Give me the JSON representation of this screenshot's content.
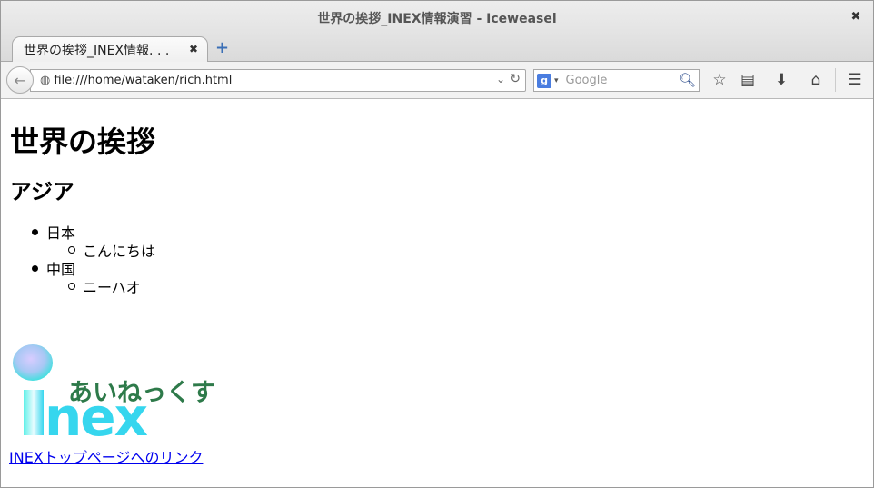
{
  "window": {
    "title": "世界の挨拶_INEX情報演習  -  Iceweasel",
    "close_glyph": "✖"
  },
  "tabs": [
    {
      "label": "世界の挨拶_INEX情報. . .",
      "active": true
    }
  ],
  "new_tab_glyph": "+",
  "navbar": {
    "url": "file:///home/wataken/rich.html",
    "search_placeholder": "Google",
    "search_engine": "g"
  },
  "page": {
    "heading": "世界の挨拶",
    "region": "アジア",
    "countries": [
      {
        "name": "日本",
        "greeting": "こんにちは"
      },
      {
        "name": "中国",
        "greeting": "ニーハオ"
      }
    ],
    "logo": {
      "word": "inex",
      "kana": "あいねっくす",
      "colors": {
        "main": "#36d6ee",
        "dot": "#c0c8f8",
        "kana": "#2e7a4a"
      }
    },
    "link_text": "INEXトップページへのリンク"
  }
}
